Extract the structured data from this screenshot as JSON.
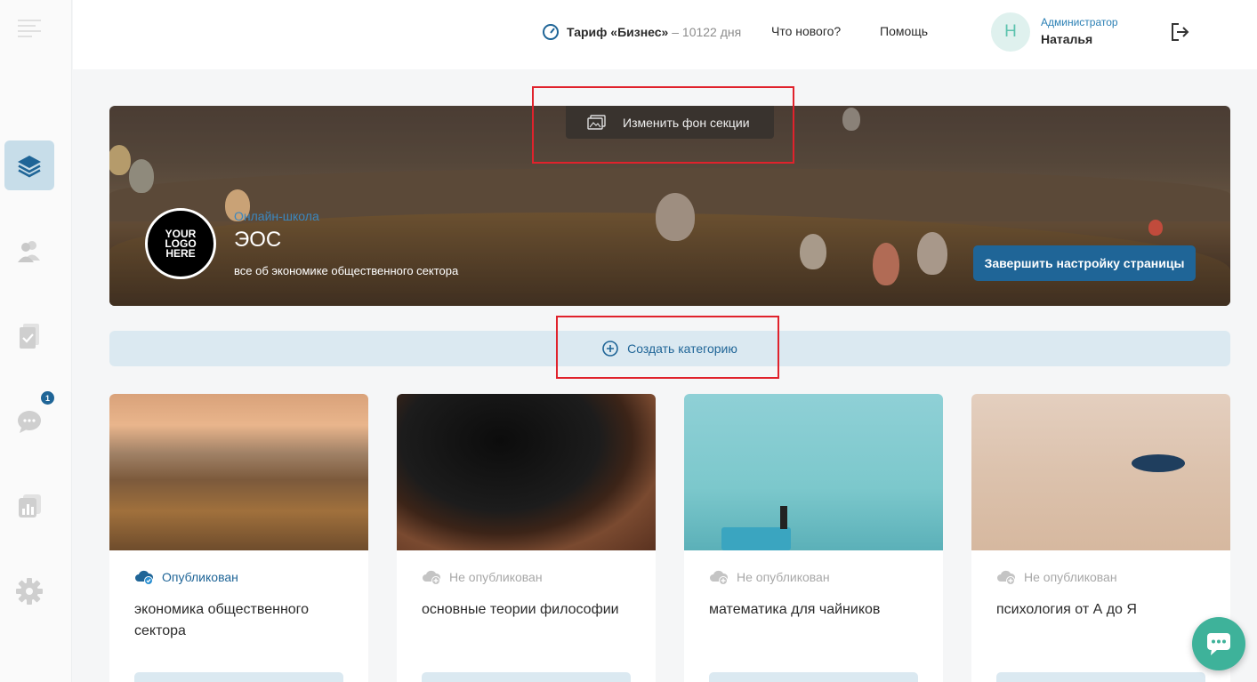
{
  "header": {
    "tariff_name": "Тариф «Бизнес»",
    "tariff_days": " – 10122 дня",
    "whats_new": "Что нового?",
    "help": "Помощь",
    "avatar_letter": "Н",
    "user_role": "Администратор",
    "user_name": "Наталья"
  },
  "sidebar": {
    "items": [
      {
        "icon": "menu-icon"
      },
      {
        "icon": "layers-icon",
        "active": true
      },
      {
        "icon": "users-icon"
      },
      {
        "icon": "document-check-icon"
      },
      {
        "icon": "chat-bubbles-icon",
        "badge": "1"
      },
      {
        "icon": "reports-icon"
      },
      {
        "icon": "gear-icon"
      }
    ]
  },
  "hero": {
    "change_bg_label": "Изменить фон секции",
    "logo_text": "YOUR LOGO HERE",
    "school_type": "Онлайн-школа",
    "school_name": "ЭОС",
    "school_desc": "все об экономике общественного сектора",
    "finish_label": "Завершить настройку страницы"
  },
  "create_category_label": "Создать категорию",
  "cards": [
    {
      "status": "Опубликован",
      "published": true,
      "title": "экономика общественного сектора"
    },
    {
      "status": "Не опубликован",
      "published": false,
      "title": "основные теории философии"
    },
    {
      "status": "Не опубликован",
      "published": false,
      "title": "математика для чайников"
    },
    {
      "status": "Не опубликован",
      "published": false,
      "title": "психология от А до Я"
    }
  ],
  "colors": {
    "accent": "#1f6597",
    "teal": "#3eb29a",
    "annotation": "#e0222c",
    "light_blue": "#dbe9f1"
  }
}
